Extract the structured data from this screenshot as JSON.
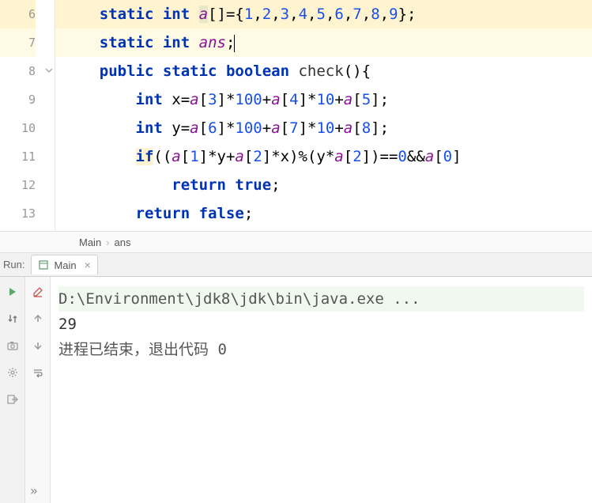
{
  "gutter": {
    "lines": [
      "6",
      "7",
      "8",
      "9",
      "10",
      "11",
      "12",
      "13"
    ]
  },
  "code": {
    "l6_pre": "    ",
    "l6_kw1": "static",
    "l6_sp1": " ",
    "l6_kw2": "int",
    "l6_sp2": " ",
    "l6_id": "a",
    "l6_mid1": "[]={",
    "l6_n1": "1",
    "l6_c1": ",",
    "l6_n2": "2",
    "l6_c2": ",",
    "l6_n3": "3",
    "l6_c3": ",",
    "l6_n4": "4",
    "l6_c4": ",",
    "l6_n5": "5",
    "l6_c5": ",",
    "l6_n6": "6",
    "l6_c6": ",",
    "l6_n7": "7",
    "l6_c7": ",",
    "l6_n8": "8",
    "l6_c8": ",",
    "l6_n9": "9",
    "l6_end": "};",
    "l7_pre": "    ",
    "l7_kw1": "static",
    "l7_sp1": " ",
    "l7_kw2": "int",
    "l7_sp2": " ",
    "l7_id": "ans",
    "l7_end": ";",
    "l8_pre": "    ",
    "l8_kw1": "public",
    "l8_sp1": " ",
    "l8_kw2": "static",
    "l8_sp2": " ",
    "l8_kw3": "boolean",
    "l8_sp3": " ",
    "l8_fn": "check",
    "l8_end": "(){",
    "l9_pre": "        ",
    "l9_kw": "int",
    "l9_sp": " x=",
    "l9_a1": "a",
    "l9_m1": "[",
    "l9_n1": "3",
    "l9_m2": "]*",
    "l9_n2": "100",
    "l9_m3": "+",
    "l9_a2": "a",
    "l9_m4": "[",
    "l9_n3": "4",
    "l9_m5": "]*",
    "l9_n4": "10",
    "l9_m6": "+",
    "l9_a3": "a",
    "l9_m7": "[",
    "l9_n5": "5",
    "l9_m8": "];",
    "l10_pre": "        ",
    "l10_kw": "int",
    "l10_sp": " y=",
    "l10_a1": "a",
    "l10_m1": "[",
    "l10_n1": "6",
    "l10_m2": "]*",
    "l10_n2": "100",
    "l10_m3": "+",
    "l10_a2": "a",
    "l10_m4": "[",
    "l10_n3": "7",
    "l10_m5": "]*",
    "l10_n4": "10",
    "l10_m6": "+",
    "l10_a3": "a",
    "l10_m7": "[",
    "l10_n5": "8",
    "l10_m8": "];",
    "l11_pre": "        ",
    "l11_if": "if",
    "l11_m1": "((",
    "l11_a1": "a",
    "l11_m2": "[",
    "l11_n1": "1",
    "l11_m3": "]*y+",
    "l11_a2": "a",
    "l11_m4": "[",
    "l11_n2": "2",
    "l11_m5": "]*x)%(y*",
    "l11_a3": "a",
    "l11_m6": "[",
    "l11_n3": "2",
    "l11_m7": "])==",
    "l11_n4": "0",
    "l11_m8": "&&",
    "l11_a4": "a",
    "l11_m9": "[",
    "l11_n5": "0",
    "l11_m10": "]",
    "l12_pre": "            ",
    "l12_kw": "return",
    "l12_sp": " ",
    "l12_kw2": "true",
    "l12_end": ";",
    "l13_pre": "        ",
    "l13_kw": "return",
    "l13_sp": " ",
    "l13_kw2": "false",
    "l13_end": ";"
  },
  "breadcrumb": {
    "item1": "Main",
    "sep": "›",
    "item2": "ans"
  },
  "run": {
    "label": "Run:",
    "tab_name": "Main"
  },
  "console": {
    "cmd": "D:\\Environment\\jdk8\\jdk\\bin\\java.exe ...",
    "out1": "29",
    "blank": "",
    "exit": "进程已结束，退出代码 0"
  },
  "icons": {
    "play": "play-icon",
    "edit": "edit-icon",
    "sort": "sort-icon",
    "camera": "camera-icon",
    "gear": "gear-icon",
    "export": "export-icon",
    "up": "arrow-up-icon",
    "down": "arrow-down-icon",
    "wrap": "soft-wrap-icon",
    "close": "close-icon",
    "expand": "expand-icon",
    "window": "window-icon"
  }
}
